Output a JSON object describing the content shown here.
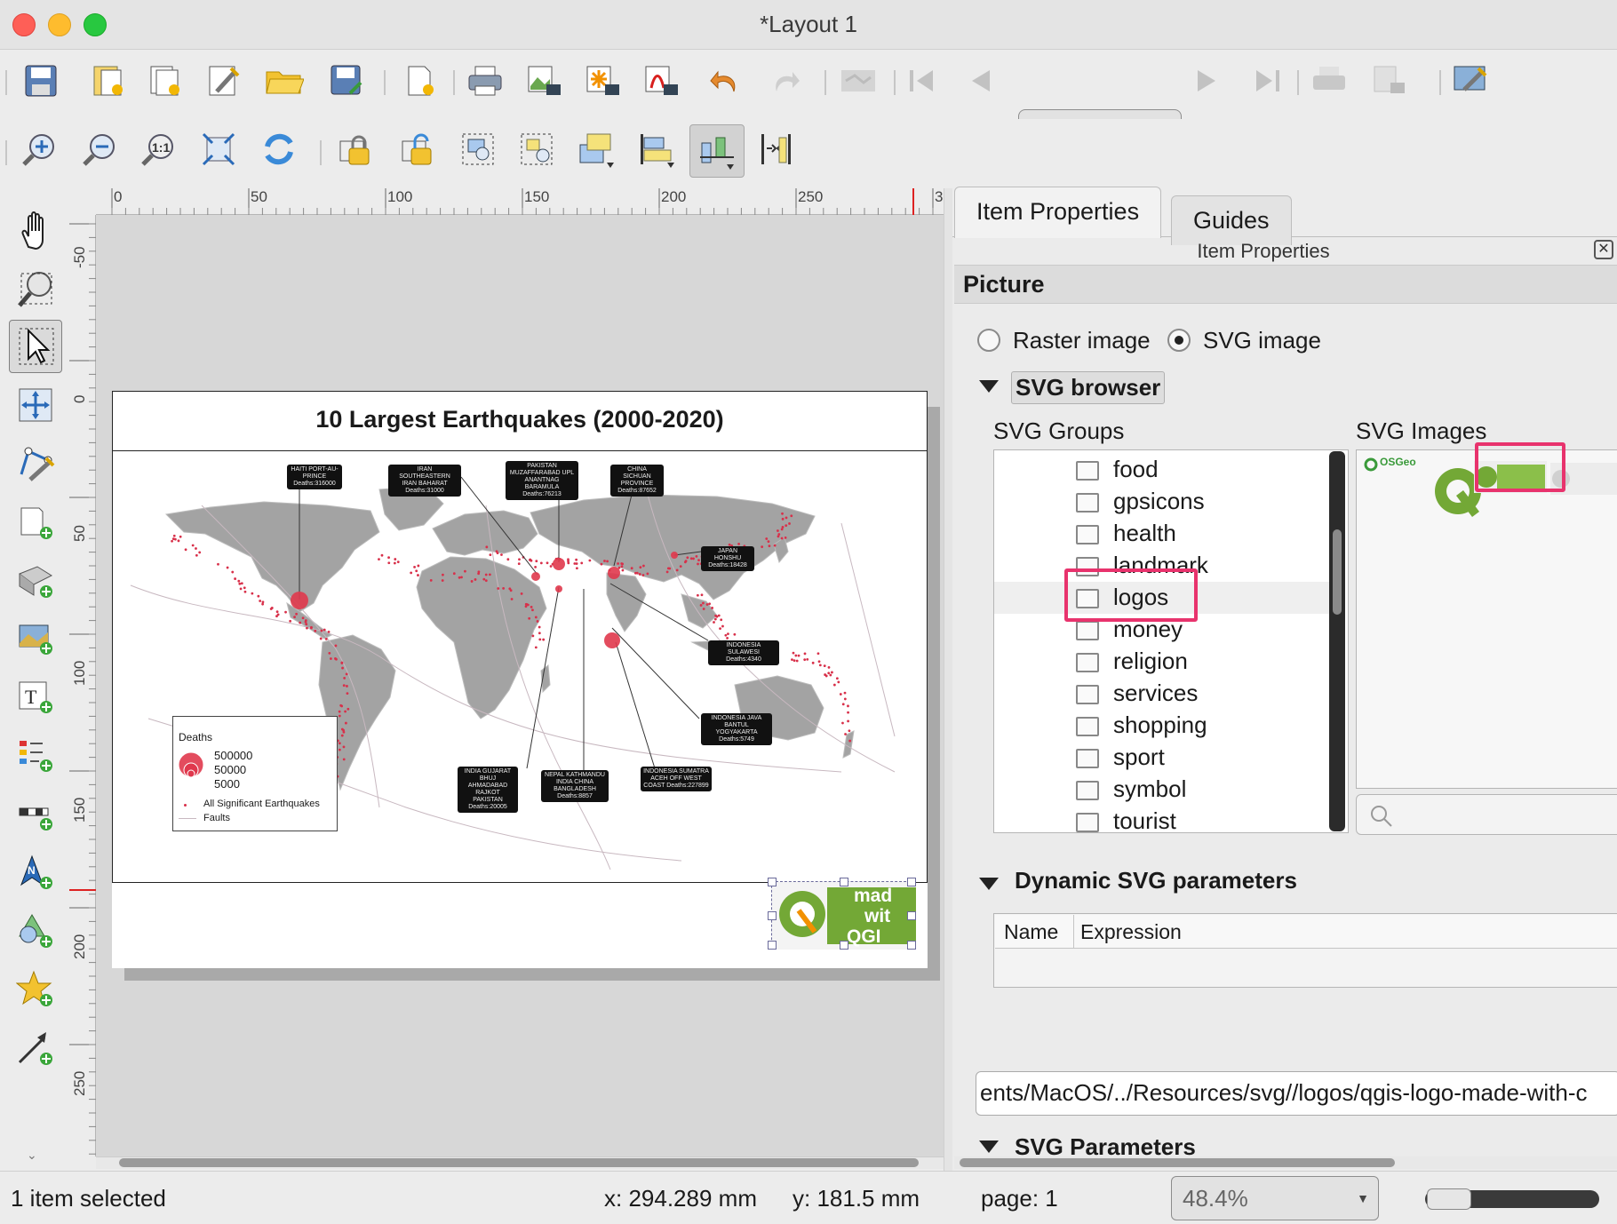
{
  "window": {
    "title": "*Layout 1"
  },
  "toolbar": {
    "page_select": {
      "value": "1"
    },
    "row1_icons": [
      "save-layout-icon",
      "new-layout-icon",
      "duplicate-layout-icon",
      "layout-manager-icon",
      "open-template-icon",
      "save-template-icon",
      "new-report-icon",
      "print-icon",
      "export-image-icon",
      "export-svg-icon",
      "export-pdf-icon",
      "undo-icon",
      "redo-icon",
      "atlas-preview-icon",
      "first-feature-icon",
      "previous-feature-icon",
      "next-feature-icon",
      "last-feature-icon",
      "print-atlas-icon",
      "export-atlas-icon",
      "atlas-settings-icon"
    ],
    "row2_icons": [
      "zoom-in-icon",
      "zoom-out-icon",
      "zoom-100-icon",
      "zoom-full-icon",
      "refresh-icon",
      "lock-items-icon",
      "unlock-items-icon",
      "group-items-icon",
      "ungroup-items-icon",
      "raise-items-icon",
      "align-left-icon",
      "distribute-icon",
      "resize-icon"
    ]
  },
  "toolbox": {
    "items": [
      "pan-icon",
      "zoom-tool-icon",
      "select-move-icon",
      "move-content-icon",
      "edit-nodes-icon",
      "add-map-icon",
      "add-3d-map-icon",
      "add-picture-icon",
      "add-label-icon",
      "add-legend-icon",
      "add-scalebar-icon",
      "add-north-arrow-icon",
      "add-shape-icon",
      "add-marker-icon",
      "add-arrow-icon"
    ]
  },
  "rulers": {
    "h_ticks": [
      "0",
      "50",
      "100",
      "150",
      "200",
      "250",
      "3"
    ],
    "v_ticks": [
      "-50",
      "0",
      "50",
      "100",
      "150",
      "200",
      "250"
    ]
  },
  "layout": {
    "map_title": "10 Largest Earthquakes (2000-2020)",
    "callouts": [
      "HAITI PORT-AU-PRINCE Deaths:316000",
      "IRAN SOUTHEASTERN IRAN BAHARAT Deaths:31000",
      "PAKISTAN MUZAFFARABAD UPL ANANTNAG BARAMULA Deaths:76213",
      "CHINA SICHUAN PROVINCE Deaths:87652",
      "JAPAN HONSHU Deaths:18428",
      "INDONESIA SULAWESI Deaths:4340",
      "INDONESIA JAVA BANTUL YOGYAKARTA Deaths:5749",
      "INDIA GUJARAT BHUJ AHMADABAD RAJKOT PAKISTAN Deaths:20005",
      "NEPAL KATHMANDU INDIA CHINA BANGLADESH Deaths:8857",
      "INDONESIA SUMATRA ACEH OFF WEST COAST Deaths:227899"
    ],
    "legend": {
      "title": "Deaths",
      "sizes": [
        "500000",
        "50000",
        "5000"
      ],
      "points_label": "All Significant Earthquakes",
      "faults_label": "Faults"
    },
    "logo_text": [
      "mad",
      "wit",
      "QGI"
    ]
  },
  "panel": {
    "tabs": [
      "Item Properties",
      "Guides"
    ],
    "title": "Item Properties",
    "section": "Picture",
    "radio_raster": "Raster image",
    "radio_svg": "SVG image",
    "svg_browser": "SVG browser",
    "svg_groups_label": "SVG Groups",
    "svg_images_label": "SVG Images",
    "groups": [
      "food",
      "gpsicons",
      "health",
      "landmark",
      "logos",
      "money",
      "religion",
      "services",
      "shopping",
      "sport",
      "symbol",
      "tourist"
    ],
    "selected_group": "logos",
    "osgeo_logo_text": "OSGeo",
    "dynamic_params": "Dynamic SVG parameters",
    "col_name": "Name",
    "col_expression": "Expression",
    "svg_path": "ents/MacOS/../Resources/svg//logos/qgis-logo-made-with-c",
    "svg_parameters": "SVG Parameters",
    "highlight_color": "#e8336d"
  },
  "status": {
    "selection": "1 item selected",
    "x": "x: 294.289 mm",
    "y": "y: 181.5 mm",
    "page": "page: 1",
    "zoom": "48.4%"
  }
}
